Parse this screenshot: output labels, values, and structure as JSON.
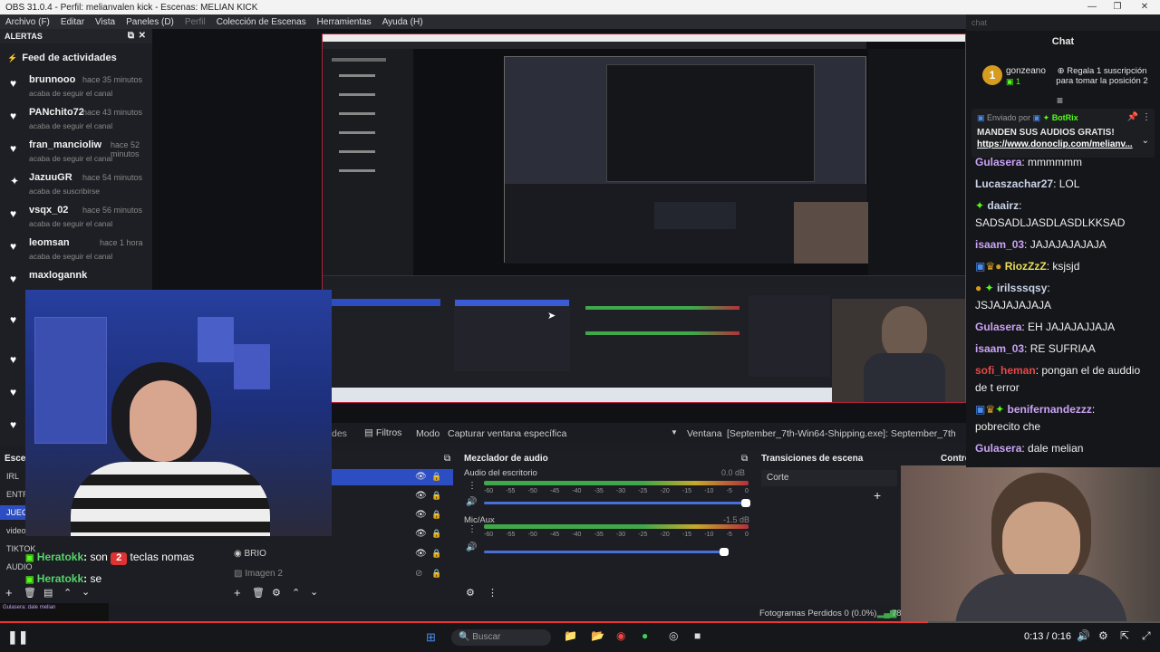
{
  "window": {
    "title": "OBS 31.0.4 - Perfil: melianvalen kick - Escenas: MELIAN KICK"
  },
  "menu": [
    "Archivo (F)",
    "Editar",
    "Vista",
    "Paneles (D)",
    "Perfil",
    "Colección de Escenas",
    "Herramientas",
    "Ayuda (H)"
  ],
  "alerts": {
    "title": "ALERTAS",
    "feed_title": "Feed de actividades",
    "items": [
      {
        "user": "brunnooo",
        "time": "hace 35 minutos",
        "action": "acaba de seguir el canal"
      },
      {
        "user": "PANchito72",
        "time": "hace 43 minutos",
        "action": "acaba de seguir el canal"
      },
      {
        "user": "fran_mancioliw",
        "time": "hace 52 minutos",
        "action": "acaba de seguir el canal"
      },
      {
        "user": "JazuuGR",
        "time": "hace 54 minutos",
        "action": "acaba de suscribirse"
      },
      {
        "user": "vsqx_02",
        "time": "hace 56 minutos",
        "action": "acaba de seguir el canal"
      },
      {
        "user": "leomsan",
        "time": "hace 1 hora",
        "action": "acaba de seguir el canal"
      },
      {
        "user": "maxlogannk",
        "time": "",
        "action": ""
      }
    ]
  },
  "scenes": {
    "title": "Escen",
    "items": [
      "IRL",
      "ENTR",
      "JUEG",
      "video",
      "TIKTOK",
      "AUDIO"
    ]
  },
  "sources_toolbar": {
    "filters_label": "Filtros",
    "mode_label": "Modo",
    "mode_value": "Capturar ventana específica",
    "window_label": "Ventana",
    "window_value": "[September_7th-Win64-Shipping.exe]: September_7th",
    "partial": "des"
  },
  "sources": {
    "items": [
      "BRIO",
      "Imagen 2"
    ]
  },
  "mixer": {
    "title": "Mezclador de audio",
    "channels": [
      {
        "name": "Audio del escritorio",
        "db": "0.0 dB",
        "level": 0.97
      },
      {
        "name": "Mic/Aux",
        "db": "-1.5 dB",
        "level": 0.87
      }
    ],
    "scale": [
      "-60",
      "-55",
      "-50",
      "-45",
      "-40",
      "-35",
      "-30",
      "-25",
      "-20",
      "-15",
      "-10",
      "-5",
      "0"
    ]
  },
  "transitions": {
    "title": "Transiciones de escena",
    "value": "Corte"
  },
  "controls": {
    "title": "Contro"
  },
  "stats": {
    "frames": "Fotogramas Perdidos 0 (0.0%)",
    "partial": "784"
  },
  "overlay_chat": [
    {
      "user": "Heratokk",
      "text": "son",
      "emote": "2",
      "rest": "teclas nomas"
    },
    {
      "user": "Heratokk",
      "text": "se"
    }
  ],
  "chat": {
    "search_placeholder": "chat",
    "title": "Chat",
    "top_gifter": {
      "name": "gonzeano",
      "count": "1",
      "rank": "1"
    },
    "gift_prompt": "Regala 1 suscripción para tomar la posición 2",
    "pinned": {
      "by_label": "Enviado por",
      "by_user": "BotRix",
      "text": "MANDEN SUS AUDIOS GRATIS!",
      "link": "https://www.donoclip.com/melianv..."
    },
    "messages": [
      {
        "user": "Gulasera",
        "color": "#c9a3f5",
        "text": "mmmmmm"
      },
      {
        "user": "Lucaszachar27",
        "color": "#c9d3e8",
        "text": "LOL"
      },
      {
        "user": "daairz",
        "color": "#c9d3e8",
        "text": "SADSADLJASDLASDLKKSAD"
      },
      {
        "user": "isaam_03",
        "color": "#c9a3f5",
        "text": "JAJAJAJAJAJA"
      },
      {
        "user": "RiozZzZ",
        "color": "#eadf5a",
        "text": "ksjsjd"
      },
      {
        "user": "irilsssqsy",
        "color": "#c9d3e8",
        "text": "JSJAJAJAJAJA"
      },
      {
        "user": "Gulasera",
        "color": "#c9a3f5",
        "text": "EH JAJAJAJJAJA"
      },
      {
        "user": "isaam_03",
        "color": "#c9a3f5",
        "text": "RE SUFRIAA"
      },
      {
        "user": "sofi_heman",
        "color": "#e04a4a",
        "text": "pongan el de auddio de t error"
      },
      {
        "user": "benifernandezzz",
        "color": "#c9a3f5",
        "text": "pobrecito che"
      },
      {
        "user": "Gulasera",
        "color": "#c9a3f5",
        "text": "dale melian"
      }
    ]
  },
  "taskbar": {
    "search_placeholder": "Buscar"
  },
  "player": {
    "time": "0:13 / 0:16"
  },
  "colors": {
    "accent_red": "#b0243a",
    "obs_blue": "#3b5bd4",
    "kick_green": "#53fc18"
  }
}
